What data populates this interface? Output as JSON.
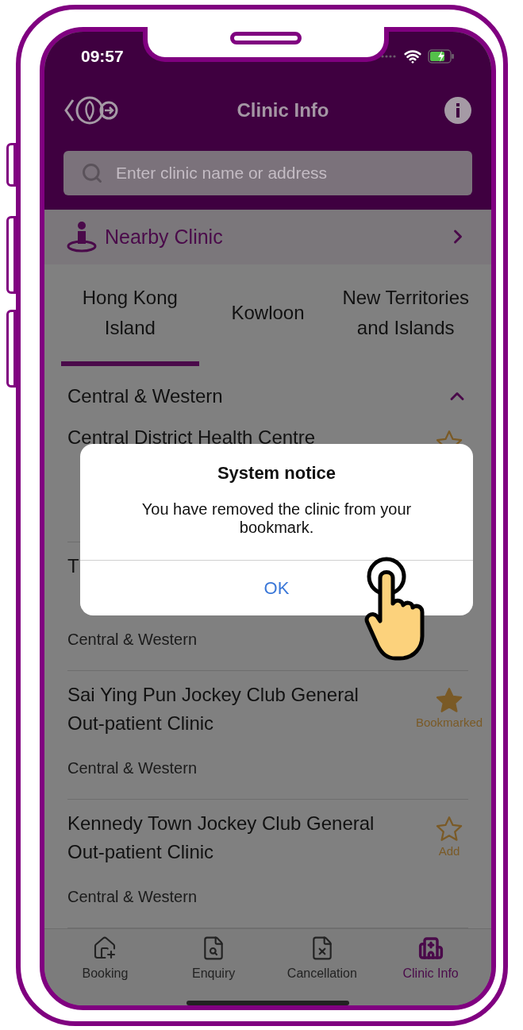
{
  "status_bar": {
    "time": "09:57"
  },
  "header": {
    "title": "Clinic Info"
  },
  "search": {
    "placeholder": "Enter clinic name or address"
  },
  "nearby": {
    "label": "Nearby Clinic"
  },
  "tabs": [
    {
      "label": "Hong Kong Island",
      "selected": true
    },
    {
      "label": "Kowloon",
      "selected": false
    },
    {
      "label": "New Territories and Islands",
      "selected": false
    }
  ],
  "section": {
    "title": "Central & Western",
    "expanded": true
  },
  "clinics": [
    {
      "lines": [
        "Central District Health Centre"
      ],
      "bookmarked": false
    },
    {
      "lines": [
        "T"
      ],
      "district": "Central & Western"
    },
    {
      "lines": [
        "Sai Ying Pun Jockey Club General",
        "Out-patient Clinic"
      ],
      "district": "Central & Western",
      "bookmarked": true,
      "bookmark_label": "Bookmarked"
    },
    {
      "lines": [
        "Kennedy Town Jockey Club General",
        "Out-patient Clinic"
      ],
      "district": "Central & Western",
      "bookmarked": false,
      "bookmark_label": "Add"
    }
  ],
  "dialog": {
    "title": "System notice",
    "message": "You have removed the clinic from your bookmark.",
    "button": "OK"
  },
  "bottom_nav": [
    {
      "label": "Booking",
      "selected": false
    },
    {
      "label": "Enquiry",
      "selected": false
    },
    {
      "label": "Cancellation",
      "selected": false
    },
    {
      "label": "Clinic Info",
      "selected": true
    }
  ]
}
